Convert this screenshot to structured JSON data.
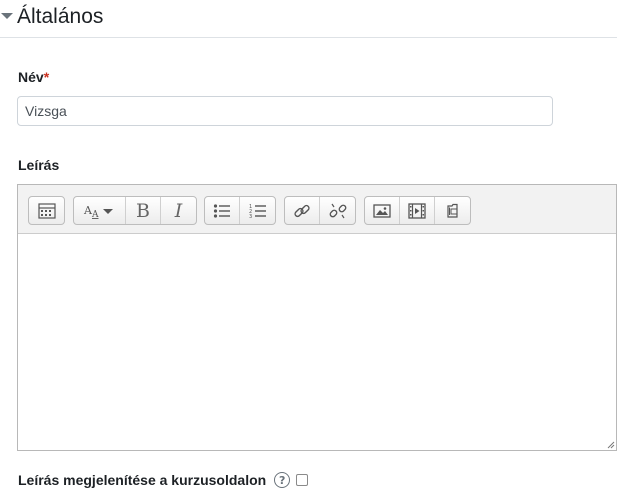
{
  "section": {
    "title": "Általános"
  },
  "name_field": {
    "label": "Név",
    "required_mark": "*",
    "value": "Vizsga"
  },
  "description_field": {
    "label": "Leírás"
  },
  "toolbar": {
    "groups": [
      [
        "toolbar-toggle-icon"
      ],
      [
        "font-style-icon",
        "bold-icon",
        "italic-icon"
      ],
      [
        "unordered-list-icon",
        "ordered-list-icon"
      ],
      [
        "link-icon",
        "unlink-icon"
      ],
      [
        "image-icon",
        "media-icon",
        "file-manage-icon"
      ]
    ],
    "bold_glyph": "B",
    "italic_glyph": "I"
  },
  "show_description": {
    "label": "Leírás megjelenítése a kurzusoldalon",
    "help_glyph": "?",
    "checked": false
  },
  "colors": {
    "required": "#ca3120",
    "text": "#1d2125",
    "border": "#ced4da"
  }
}
